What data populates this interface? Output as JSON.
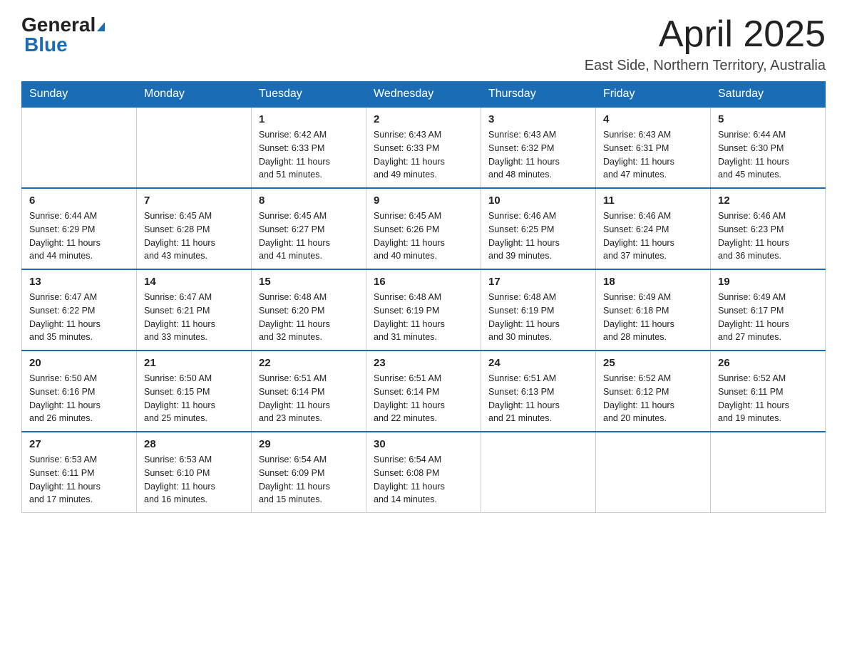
{
  "header": {
    "logo_general": "General",
    "logo_blue": "Blue",
    "month_title": "April 2025",
    "location": "East Side, Northern Territory, Australia"
  },
  "weekdays": [
    "Sunday",
    "Monday",
    "Tuesday",
    "Wednesday",
    "Thursday",
    "Friday",
    "Saturday"
  ],
  "weeks": [
    [
      {
        "day": "",
        "info": ""
      },
      {
        "day": "",
        "info": ""
      },
      {
        "day": "1",
        "info": "Sunrise: 6:42 AM\nSunset: 6:33 PM\nDaylight: 11 hours\nand 51 minutes."
      },
      {
        "day": "2",
        "info": "Sunrise: 6:43 AM\nSunset: 6:33 PM\nDaylight: 11 hours\nand 49 minutes."
      },
      {
        "day": "3",
        "info": "Sunrise: 6:43 AM\nSunset: 6:32 PM\nDaylight: 11 hours\nand 48 minutes."
      },
      {
        "day": "4",
        "info": "Sunrise: 6:43 AM\nSunset: 6:31 PM\nDaylight: 11 hours\nand 47 minutes."
      },
      {
        "day": "5",
        "info": "Sunrise: 6:44 AM\nSunset: 6:30 PM\nDaylight: 11 hours\nand 45 minutes."
      }
    ],
    [
      {
        "day": "6",
        "info": "Sunrise: 6:44 AM\nSunset: 6:29 PM\nDaylight: 11 hours\nand 44 minutes."
      },
      {
        "day": "7",
        "info": "Sunrise: 6:45 AM\nSunset: 6:28 PM\nDaylight: 11 hours\nand 43 minutes."
      },
      {
        "day": "8",
        "info": "Sunrise: 6:45 AM\nSunset: 6:27 PM\nDaylight: 11 hours\nand 41 minutes."
      },
      {
        "day": "9",
        "info": "Sunrise: 6:45 AM\nSunset: 6:26 PM\nDaylight: 11 hours\nand 40 minutes."
      },
      {
        "day": "10",
        "info": "Sunrise: 6:46 AM\nSunset: 6:25 PM\nDaylight: 11 hours\nand 39 minutes."
      },
      {
        "day": "11",
        "info": "Sunrise: 6:46 AM\nSunset: 6:24 PM\nDaylight: 11 hours\nand 37 minutes."
      },
      {
        "day": "12",
        "info": "Sunrise: 6:46 AM\nSunset: 6:23 PM\nDaylight: 11 hours\nand 36 minutes."
      }
    ],
    [
      {
        "day": "13",
        "info": "Sunrise: 6:47 AM\nSunset: 6:22 PM\nDaylight: 11 hours\nand 35 minutes."
      },
      {
        "day": "14",
        "info": "Sunrise: 6:47 AM\nSunset: 6:21 PM\nDaylight: 11 hours\nand 33 minutes."
      },
      {
        "day": "15",
        "info": "Sunrise: 6:48 AM\nSunset: 6:20 PM\nDaylight: 11 hours\nand 32 minutes."
      },
      {
        "day": "16",
        "info": "Sunrise: 6:48 AM\nSunset: 6:19 PM\nDaylight: 11 hours\nand 31 minutes."
      },
      {
        "day": "17",
        "info": "Sunrise: 6:48 AM\nSunset: 6:19 PM\nDaylight: 11 hours\nand 30 minutes."
      },
      {
        "day": "18",
        "info": "Sunrise: 6:49 AM\nSunset: 6:18 PM\nDaylight: 11 hours\nand 28 minutes."
      },
      {
        "day": "19",
        "info": "Sunrise: 6:49 AM\nSunset: 6:17 PM\nDaylight: 11 hours\nand 27 minutes."
      }
    ],
    [
      {
        "day": "20",
        "info": "Sunrise: 6:50 AM\nSunset: 6:16 PM\nDaylight: 11 hours\nand 26 minutes."
      },
      {
        "day": "21",
        "info": "Sunrise: 6:50 AM\nSunset: 6:15 PM\nDaylight: 11 hours\nand 25 minutes."
      },
      {
        "day": "22",
        "info": "Sunrise: 6:51 AM\nSunset: 6:14 PM\nDaylight: 11 hours\nand 23 minutes."
      },
      {
        "day": "23",
        "info": "Sunrise: 6:51 AM\nSunset: 6:14 PM\nDaylight: 11 hours\nand 22 minutes."
      },
      {
        "day": "24",
        "info": "Sunrise: 6:51 AM\nSunset: 6:13 PM\nDaylight: 11 hours\nand 21 minutes."
      },
      {
        "day": "25",
        "info": "Sunrise: 6:52 AM\nSunset: 6:12 PM\nDaylight: 11 hours\nand 20 minutes."
      },
      {
        "day": "26",
        "info": "Sunrise: 6:52 AM\nSunset: 6:11 PM\nDaylight: 11 hours\nand 19 minutes."
      }
    ],
    [
      {
        "day": "27",
        "info": "Sunrise: 6:53 AM\nSunset: 6:11 PM\nDaylight: 11 hours\nand 17 minutes."
      },
      {
        "day": "28",
        "info": "Sunrise: 6:53 AM\nSunset: 6:10 PM\nDaylight: 11 hours\nand 16 minutes."
      },
      {
        "day": "29",
        "info": "Sunrise: 6:54 AM\nSunset: 6:09 PM\nDaylight: 11 hours\nand 15 minutes."
      },
      {
        "day": "30",
        "info": "Sunrise: 6:54 AM\nSunset: 6:08 PM\nDaylight: 11 hours\nand 14 minutes."
      },
      {
        "day": "",
        "info": ""
      },
      {
        "day": "",
        "info": ""
      },
      {
        "day": "",
        "info": ""
      }
    ]
  ]
}
